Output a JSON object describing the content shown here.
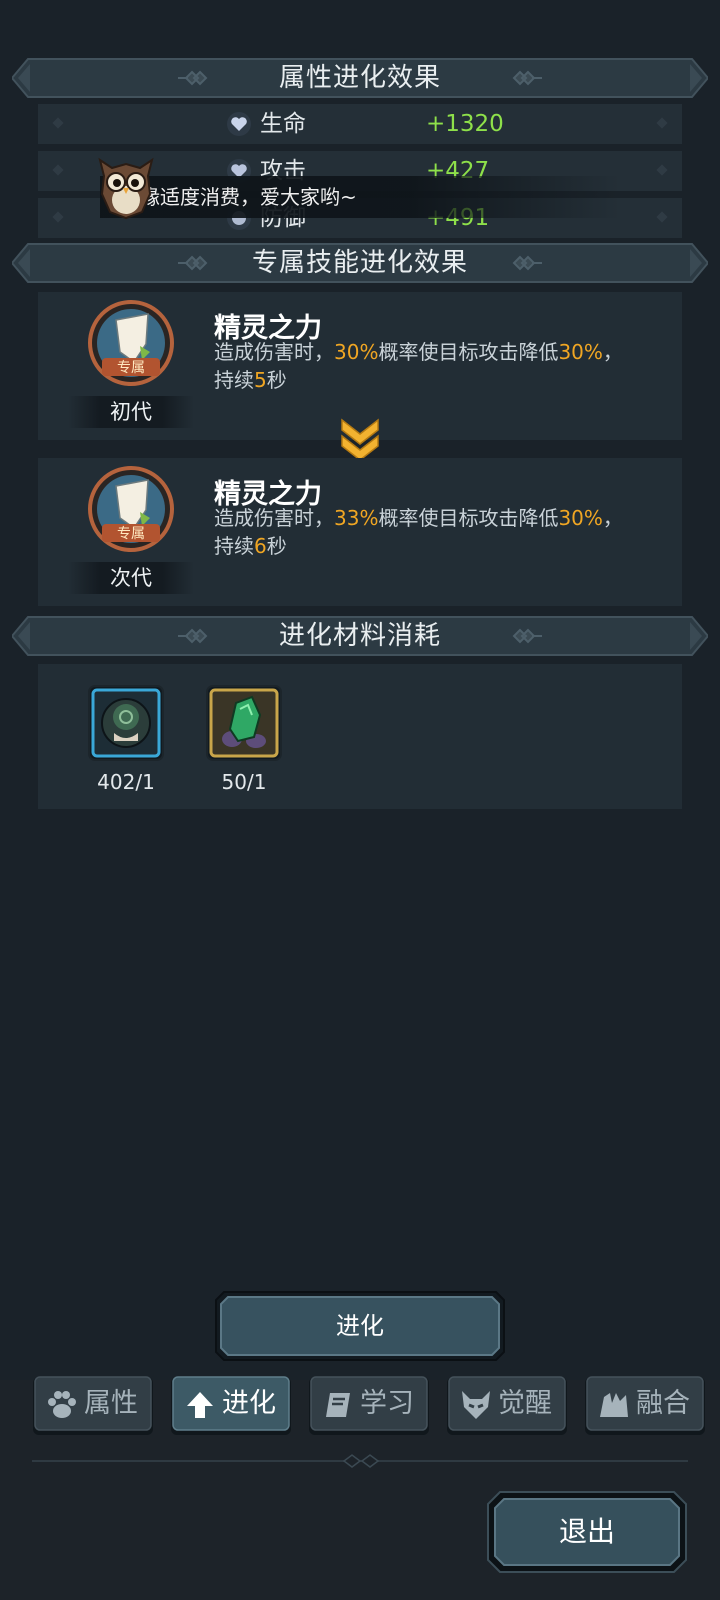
{
  "sections": {
    "attr_title": "属性进化效果",
    "skill_title": "专属技能进化效果",
    "material_title": "进化材料消耗"
  },
  "stats": [
    {
      "icon": "heart-icon",
      "name": "生命",
      "value": "+1320"
    },
    {
      "icon": "attack-icon",
      "name": "攻击",
      "value": "+427"
    },
    {
      "icon": "shield-icon",
      "name": "防御",
      "value": "+491"
    }
  ],
  "notice": {
    "text": "缘适度消费，爱大家哟~",
    "mascot": "owl-mascot-icon"
  },
  "skills": [
    {
      "badge": "专属",
      "generation": "初代",
      "name": "精灵之力",
      "desc_1": "造成伤害时，",
      "chance": "30%",
      "desc_2": "概率使目标攻击降低",
      "reduce": "30%",
      "desc_3": "，",
      "desc_4": "持续",
      "duration": "5",
      "desc_5": "秒"
    },
    {
      "badge": "专属",
      "generation": "次代",
      "name": "精灵之力",
      "desc_1": "造成伤害时，",
      "chance": "33%",
      "desc_2": "概率使目标攻击降低",
      "reduce": "30%",
      "desc_3": "，",
      "desc_4": "持续",
      "duration": "6",
      "desc_5": "秒"
    }
  ],
  "materials": [
    {
      "icon": "hero-fragment-icon",
      "count": "402/1",
      "frame": "#3aa8d8"
    },
    {
      "icon": "green-stone-icon",
      "count": "50/1",
      "frame": "#c9a64a"
    }
  ],
  "evolve_button": "进化",
  "tabs": [
    {
      "label": "属性",
      "icon": "paw-icon",
      "active": false
    },
    {
      "label": "进化",
      "icon": "up-arrow-icon",
      "active": true
    },
    {
      "label": "学习",
      "icon": "book-icon",
      "active": false
    },
    {
      "label": "觉醒",
      "icon": "demon-mask-icon",
      "active": false
    },
    {
      "label": "融合",
      "icon": "fusion-icon",
      "active": false
    }
  ],
  "exit_button": "退出",
  "colors": {
    "background": "#1a2229",
    "panel": "#222d35",
    "stat_value": "#8ee04a",
    "highlight": "#f0a623"
  }
}
